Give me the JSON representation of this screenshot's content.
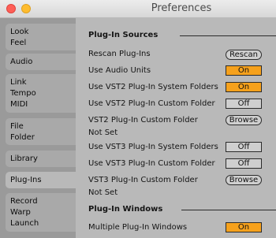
{
  "window": {
    "title": "Preferences"
  },
  "sidebar": {
    "tabs": [
      {
        "lines": [
          "Look",
          "Feel"
        ]
      },
      {
        "lines": [
          "Audio"
        ]
      },
      {
        "lines": [
          "Link",
          "Tempo",
          "MIDI"
        ]
      },
      {
        "lines": [
          "File",
          "Folder"
        ]
      },
      {
        "lines": [
          "Library"
        ]
      },
      {
        "lines": [
          "Plug-Ins"
        ],
        "active": true
      },
      {
        "lines": [
          "Record",
          "Warp",
          "Launch"
        ]
      }
    ]
  },
  "plugin_sources": {
    "header": "Plug-In Sources",
    "rescan": {
      "label": "Rescan Plug-Ins",
      "button": "Rescan"
    },
    "audio_units": {
      "label": "Use Audio Units",
      "value": "On"
    },
    "vst2_system": {
      "label": "Use VST2 Plug-In System Folders",
      "value": "On"
    },
    "vst2_custom": {
      "label": "Use VST2 Plug-In Custom Folder",
      "value": "Off"
    },
    "vst2_folder": {
      "label": "VST2 Plug-In Custom Folder",
      "button": "Browse",
      "path": "Not Set"
    },
    "vst3_system": {
      "label": "Use VST3 Plug-In System Folders",
      "value": "Off"
    },
    "vst3_custom": {
      "label": "Use VST3 Plug-In Custom Folder",
      "value": "Off"
    },
    "vst3_folder": {
      "label": "VST3 Plug-In Custom Folder",
      "button": "Browse",
      "path": "Not Set"
    }
  },
  "plugin_windows": {
    "header": "Plug-In Windows",
    "multiple": {
      "label": "Multiple Plug-In Windows",
      "value": "On"
    }
  },
  "colors": {
    "accent_on": "#f6a11c",
    "panel": "#b9b9b9",
    "sidebar": "#9a9a9a"
  }
}
